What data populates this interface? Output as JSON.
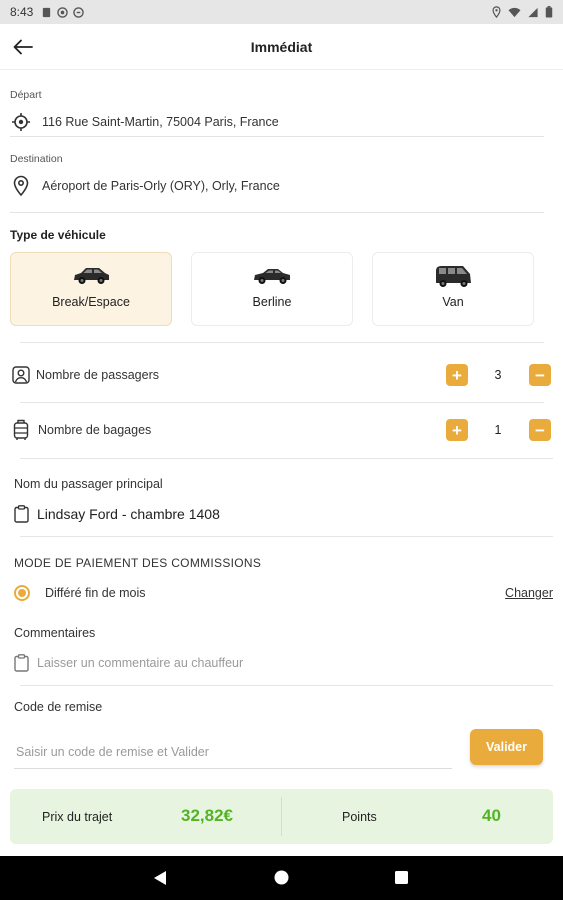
{
  "status_bar": {
    "time": "8:43"
  },
  "app_bar": {
    "title": "Immédiat"
  },
  "departure": {
    "label": "Départ",
    "address": "116 Rue Saint-Martin, 75004 Paris, France"
  },
  "destination": {
    "label": "Destination",
    "address": "Aéroport de Paris-Orly (ORY), Orly, France"
  },
  "vehicle": {
    "title": "Type de véhicule",
    "options": [
      {
        "label": "Break/Espace",
        "selected": true
      },
      {
        "label": "Berline",
        "selected": false
      },
      {
        "label": "Van",
        "selected": false
      }
    ]
  },
  "passengers": {
    "label": "Nombre de passagers",
    "value": "3"
  },
  "luggage": {
    "label": "Nombre de bagages",
    "value": "1"
  },
  "main_passenger": {
    "label": "Nom du passager principal",
    "value": "Lindsay Ford - chambre 1408"
  },
  "payment": {
    "title": "MODE DE PAIEMENT DES COMMISSIONS",
    "option": "Différé fin de mois",
    "change_label": "Changer"
  },
  "comments": {
    "label": "Commentaires",
    "placeholder": "Laisser un commentaire au chauffeur"
  },
  "discount": {
    "label": "Code de remise",
    "placeholder": "Saisir un code de remise et Valider",
    "button": "Valider"
  },
  "summary": {
    "price_label": "Prix du trajet",
    "price_value": "32,82€",
    "points_label": "Points",
    "points_value": "40"
  },
  "colors": {
    "accent": "#e8ab3c",
    "selected_bg": "#fdf3e3",
    "summary_bg": "#e7f5e0",
    "summary_value": "#52b423"
  },
  "icons": [
    "back-arrow-icon",
    "target-icon",
    "location-pin-icon",
    "car-icon",
    "user-icon",
    "luggage-icon",
    "clipboard-icon",
    "radio-icon",
    "nav-back-icon",
    "nav-home-icon",
    "nav-recents-icon"
  ]
}
